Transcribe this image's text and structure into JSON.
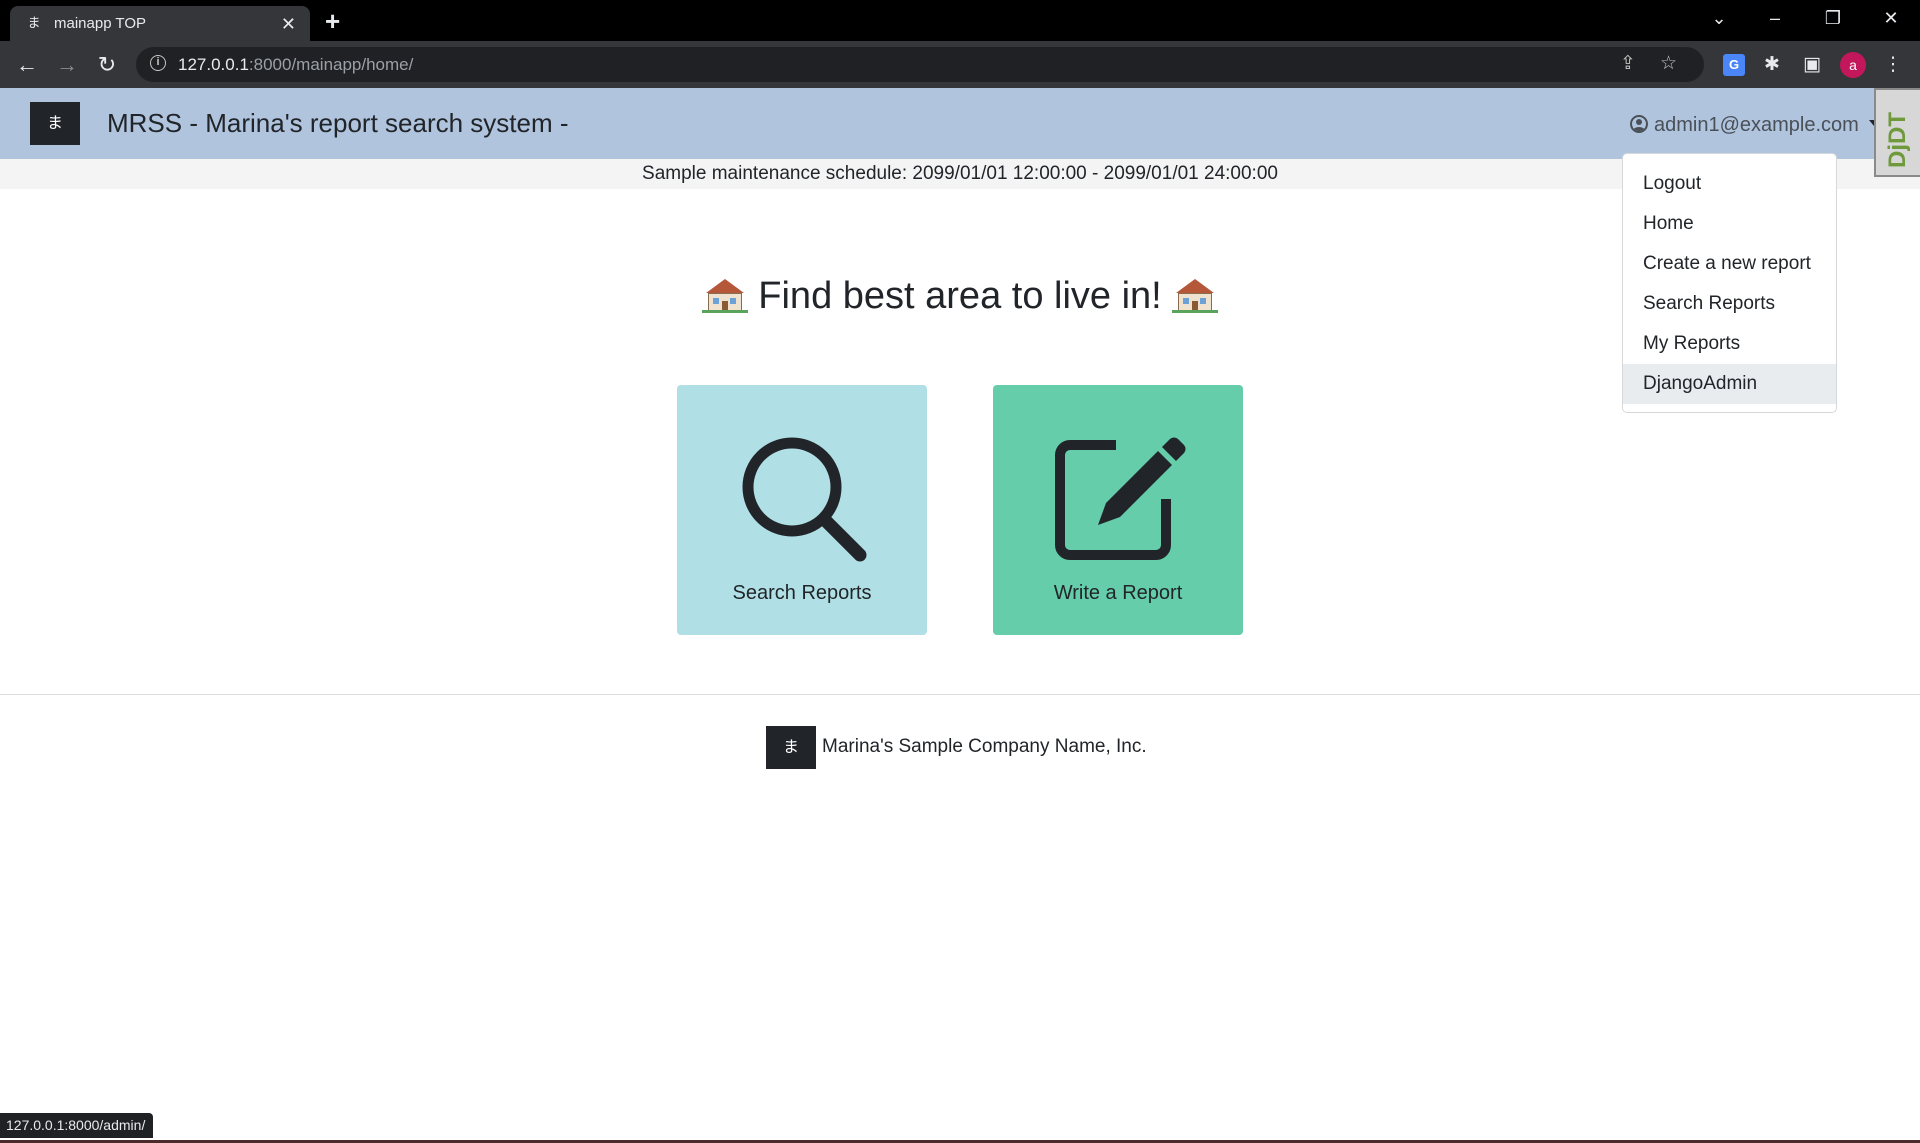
{
  "browser": {
    "tab_title": "mainapp TOP",
    "tab_favicon": "ま",
    "url_host": "127.0.0.1",
    "url_rest": ":8000/mainapp/home/",
    "profile_initial": "a",
    "status_url": "127.0.0.1:8000/admin/",
    "icons": [
      "back-icon",
      "forward-icon",
      "reload-icon",
      "info-icon",
      "share-icon",
      "star-icon",
      "translate-icon",
      "extensions-icon",
      "side-panel-icon",
      "menu-icon"
    ]
  },
  "navbar": {
    "logo_char": "ま",
    "brand": "MRSS - Marina's report search system -",
    "user_email": "admin1@example.com",
    "bg_color": "#b0c4de"
  },
  "djdt": {
    "label": "DjDT"
  },
  "maintenance": "Sample maintenance schedule: 2099/01/01 12:00:00 - 2099/01/01 24:00:00",
  "dropdown": {
    "items": [
      {
        "label": "Logout"
      },
      {
        "label": "Home"
      },
      {
        "label": "Create a new report"
      },
      {
        "label": "Search Reports"
      },
      {
        "label": "My Reports"
      },
      {
        "label": "DjangoAdmin",
        "highlighted": true
      }
    ]
  },
  "hero": {
    "title": "Find best area to live in!"
  },
  "cards": [
    {
      "label": "Search Reports",
      "icon": "search-icon",
      "color": "#b0e0e6"
    },
    {
      "label": "Write a Report",
      "icon": "edit-icon",
      "color": "#66cdaa"
    }
  ],
  "footer": {
    "logo_char": "ま",
    "company": "Marina's Sample Company Name, Inc."
  }
}
